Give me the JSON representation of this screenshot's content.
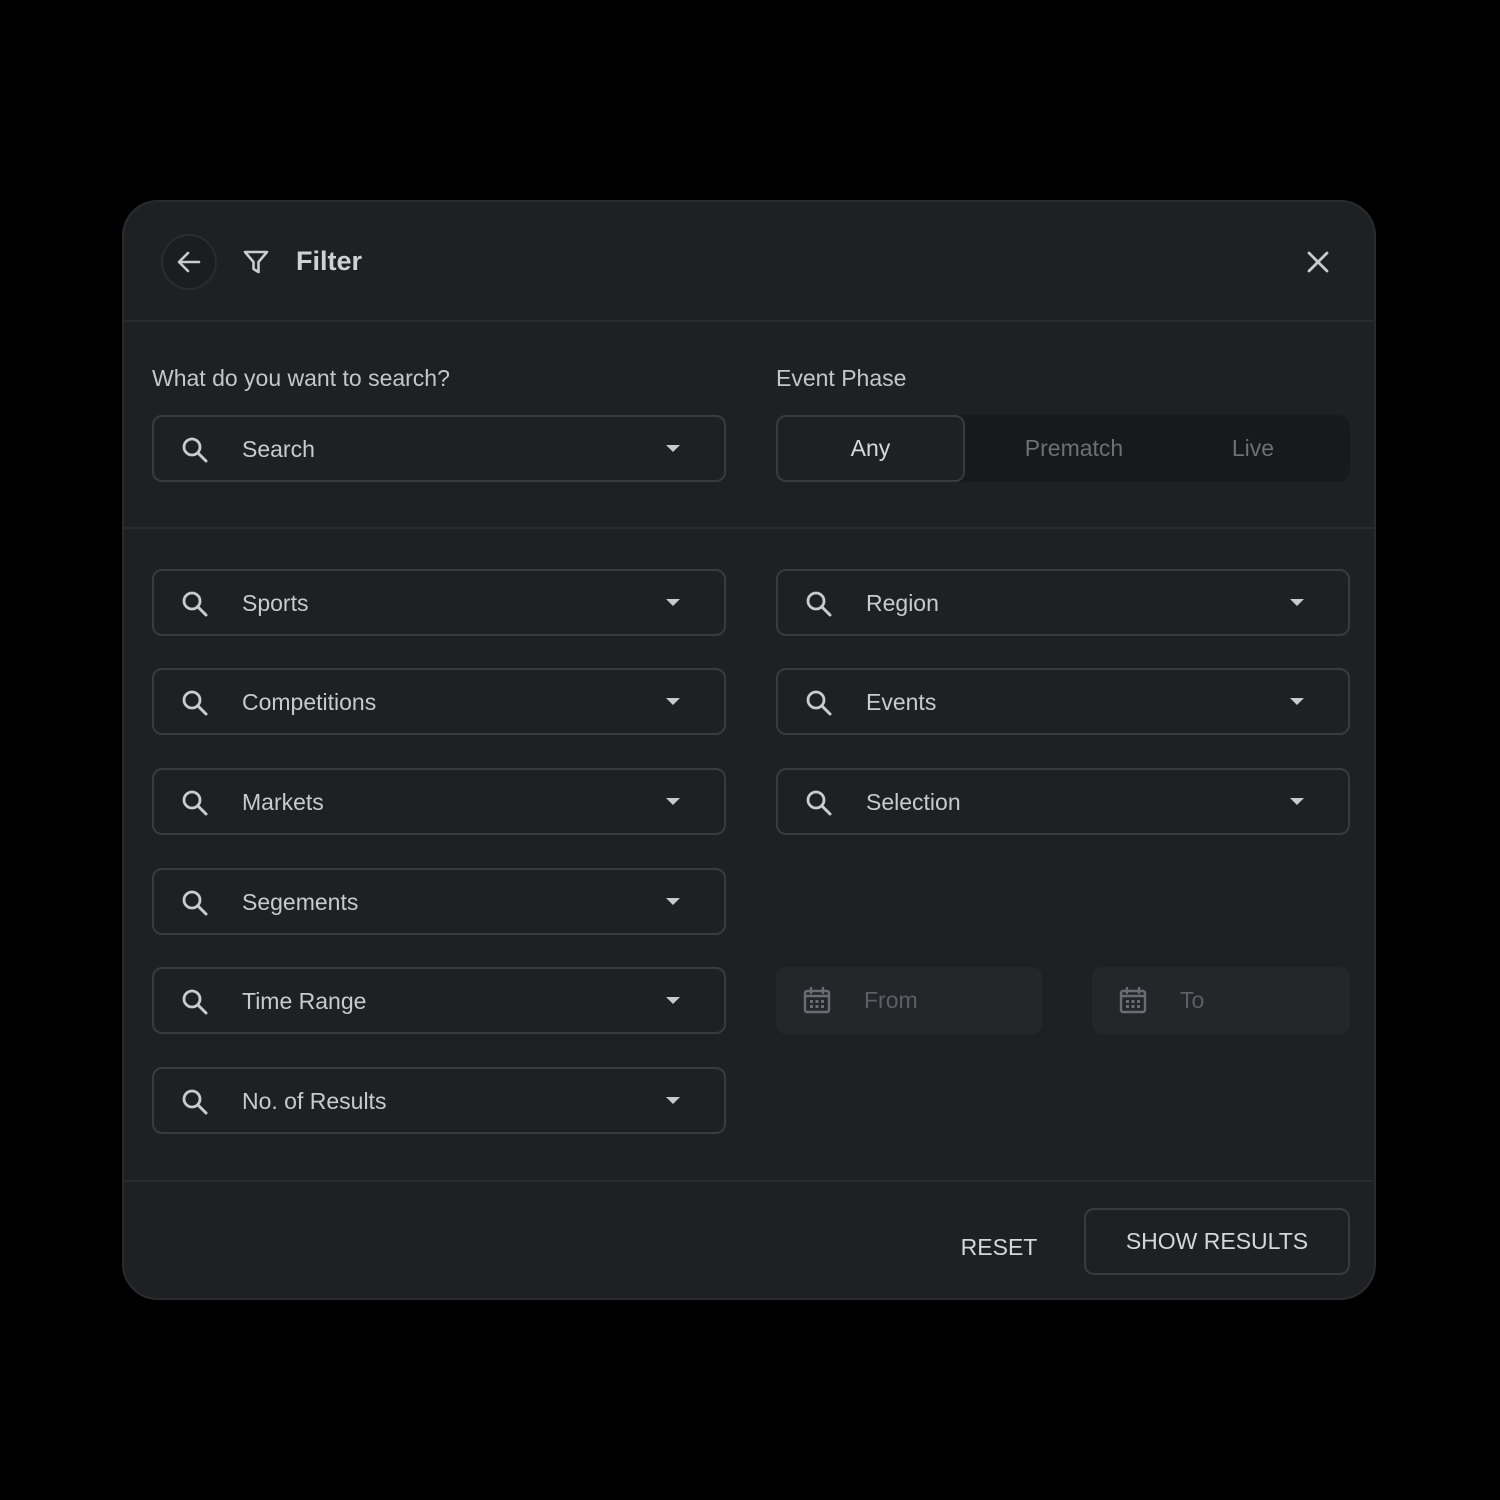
{
  "header": {
    "title": "Filter",
    "back_icon": "arrow-left-icon",
    "filter_icon": "funnel-icon",
    "close_icon": "close-icon"
  },
  "search_section": {
    "label": "What do you want to search?",
    "search_placeholder": "Search"
  },
  "event_phase": {
    "label": "Event Phase",
    "options": [
      "Any",
      "Prematch",
      "Live"
    ],
    "selected": "Any"
  },
  "left_fields": [
    "Sports",
    "Competitions",
    "Markets",
    "Segements",
    "Time Range",
    "No. of Results"
  ],
  "right_fields": [
    "Region",
    "Events",
    "Selection"
  ],
  "date_range": {
    "from_placeholder": "From",
    "to_placeholder": "To"
  },
  "footer": {
    "reset_label": "RESET",
    "show_results_label": "SHOW RESULTS"
  }
}
